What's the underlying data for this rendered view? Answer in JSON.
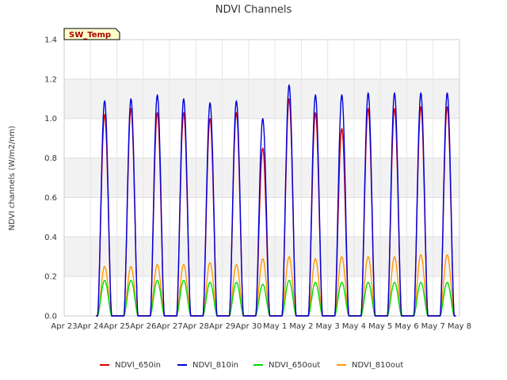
{
  "chart_data": {
    "type": "line",
    "title": "NDVI Channels",
    "ylabel": "NDVI channels (W/m2/nm)",
    "xlabel": "",
    "site_tag": "SW_Temp",
    "ylim": [
      0,
      1.4
    ],
    "yticks": [
      "0.0",
      "0.2",
      "0.4",
      "0.6",
      "0.8",
      "1.0",
      "1.2",
      "1.4"
    ],
    "xlim": [
      0,
      15
    ],
    "xticks": [
      "Apr 23",
      "Apr 24",
      "Apr 25",
      "Apr 26",
      "Apr 27",
      "Apr 28",
      "Apr 29",
      "Apr 30",
      "May 1",
      "May 2",
      "May 3",
      "May 4",
      "May 5",
      "May 6",
      "May 7",
      "May 8"
    ],
    "grid": true,
    "legend_position": "bottom",
    "days": [
      "Apr 24",
      "Apr 25",
      "Apr 26",
      "Apr 27",
      "Apr 28",
      "Apr 29",
      "Apr 30",
      "May 1",
      "May 2",
      "May 3",
      "May 4",
      "May 5",
      "May 6",
      "May 7"
    ],
    "series": [
      {
        "name": "NDVI_650in",
        "color": "#dd0000",
        "daily_peak": [
          1.02,
          1.05,
          1.03,
          1.03,
          1.0,
          1.03,
          0.85,
          1.1,
          1.03,
          0.95,
          1.05,
          1.05,
          1.06,
          1.06
        ]
      },
      {
        "name": "NDVI_810in",
        "color": "#0000dd",
        "daily_peak": [
          1.09,
          1.1,
          1.12,
          1.1,
          1.08,
          1.09,
          1.0,
          1.17,
          1.12,
          1.12,
          1.13,
          1.13,
          1.13,
          1.13
        ]
      },
      {
        "name": "NDVI_650out",
        "color": "#00dd00",
        "daily_peak": [
          0.18,
          0.18,
          0.18,
          0.18,
          0.17,
          0.17,
          0.16,
          0.18,
          0.17,
          0.17,
          0.17,
          0.17,
          0.17,
          0.17
        ]
      },
      {
        "name": "NDVI_810out",
        "color": "#ff9900",
        "daily_peak": [
          0.25,
          0.25,
          0.26,
          0.26,
          0.27,
          0.26,
          0.29,
          0.3,
          0.29,
          0.3,
          0.3,
          0.3,
          0.31,
          0.31
        ]
      }
    ]
  }
}
